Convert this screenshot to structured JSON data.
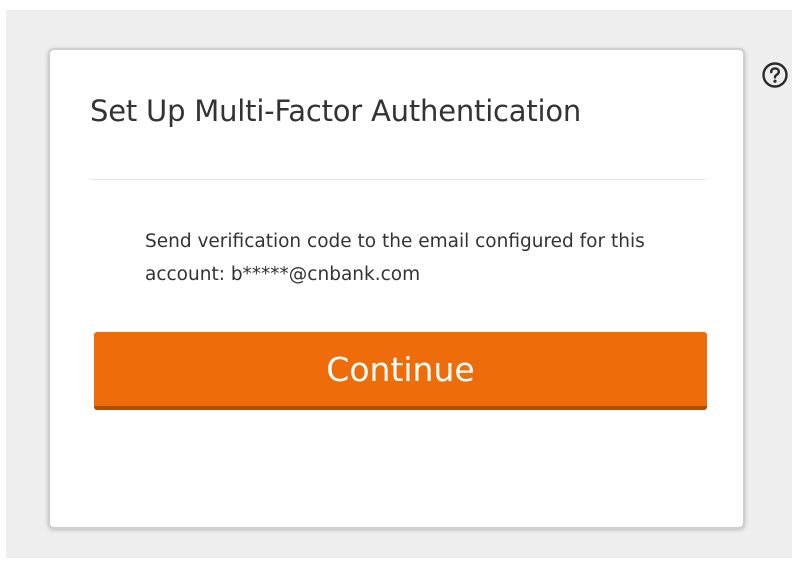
{
  "dialog": {
    "title": "Set Up Multi-Factor Authentication",
    "message": "Send verification code to the email configured for this account: b*****@cnbank.com",
    "continue_label": "Continue"
  },
  "help": {
    "icon": "question-circle-icon"
  },
  "colors": {
    "accent": "#ef6c0a",
    "background": "#eeeeee",
    "card": "#ffffff",
    "text": "#333333"
  }
}
